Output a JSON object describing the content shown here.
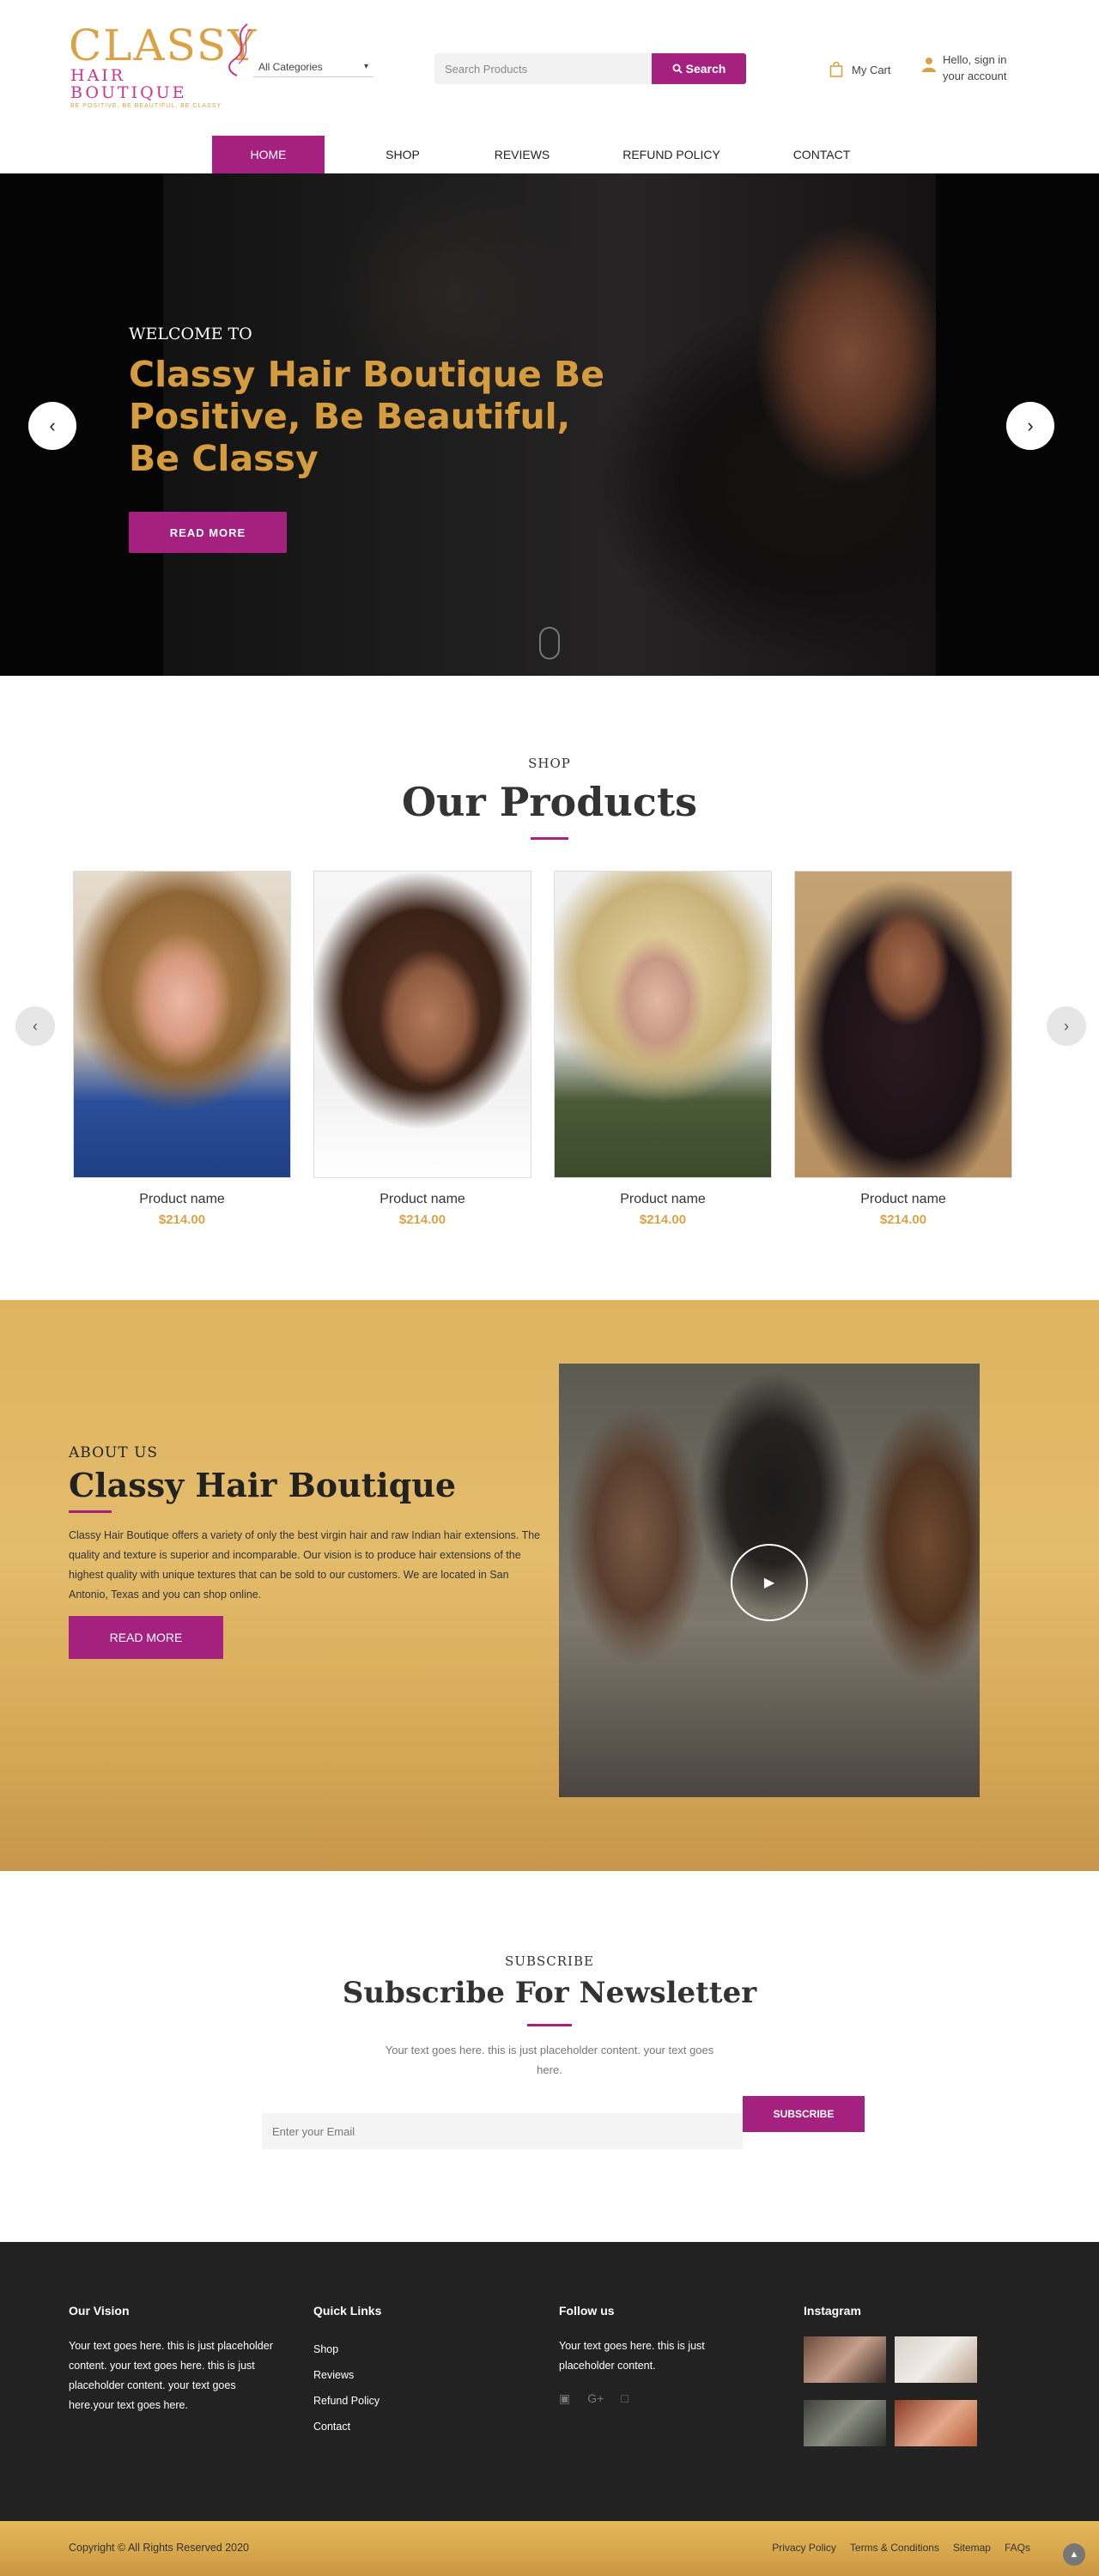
{
  "header": {
    "logo_main": "CLASSY",
    "logo_sub": "HAIR BOUTIQUE",
    "logo_tagline": "BE POSITIVE, BE BEAUTIFUL, BE CLASSY",
    "category_select": "All Categories",
    "search_placeholder": "Search Products",
    "search_button": "Search",
    "cart_label": "My Cart",
    "account_line1": "Hello, sign in",
    "account_line2": "your account"
  },
  "nav": {
    "items": [
      {
        "label": "HOME"
      },
      {
        "label": "SHOP"
      },
      {
        "label": "REVIEWS"
      },
      {
        "label": "REFUND POLICY"
      },
      {
        "label": "CONTACT"
      }
    ]
  },
  "hero": {
    "welcome": "WELCOME TO",
    "title": "Classy Hair Boutique Be Positive, Be Beautiful, Be Classy",
    "button": "READ MORE"
  },
  "products_section": {
    "eyebrow": "SHOP",
    "title": "Our Products",
    "items": [
      {
        "name": "Product name",
        "price": "$214.00"
      },
      {
        "name": "Product name",
        "price": "$214.00"
      },
      {
        "name": "Product name",
        "price": "$214.00"
      },
      {
        "name": "Product name",
        "price": "$214.00"
      }
    ]
  },
  "about": {
    "eyebrow": "ABOUT US",
    "title": "Classy Hair Boutique",
    "text": "Classy Hair Boutique offers a variety of only the best virgin hair and raw Indian hair extensions. The quality and texture is superior and incomparable. Our vision is to produce hair extensions of the highest quality with unique textures that can be sold to our customers. We are located in San Antonio, Texas and you can shop online.",
    "button": "READ MORE"
  },
  "newsletter": {
    "eyebrow": "SUBSCRIBE",
    "title": "Subscribe For Newsletter",
    "text": "Your text goes here. this is just placeholder content. your text goes here.",
    "email_placeholder": "Enter your Email",
    "button": "SUBSCRIBE"
  },
  "footer": {
    "vision_head": "Our Vision",
    "vision_text": "Your text goes here. this is just placeholder content. your text goes here. this is just placeholder content. your text goes here.your text goes here.",
    "links_head": "Quick Links",
    "links": [
      "Shop",
      "Reviews",
      "Refund Policy",
      "Contact"
    ],
    "follow_head": "Follow us",
    "follow_text": "Your text goes here. this is just placeholder content.",
    "instagram_head": "Instagram",
    "copyright": "Copyright © All Rights Reserved 2020",
    "legal": [
      "Privacy Policy",
      "Terms & Conditions",
      "Sitemap",
      "FAQs"
    ]
  },
  "icons": {
    "search": "search-icon",
    "cart": "shopping-bag-icon",
    "account": "user-icon",
    "prev": "chevron-left-icon",
    "next": "chevron-right-icon",
    "play": "play-icon",
    "facebook": "facebook-icon",
    "google_plus": "google-plus-icon",
    "twitter": "twitter-icon",
    "back_to_top": "chevron-up-icon"
  },
  "colors": {
    "brand_magenta": "#a4217f",
    "brand_gold": "#d9a246",
    "footer_dark": "#222223"
  }
}
